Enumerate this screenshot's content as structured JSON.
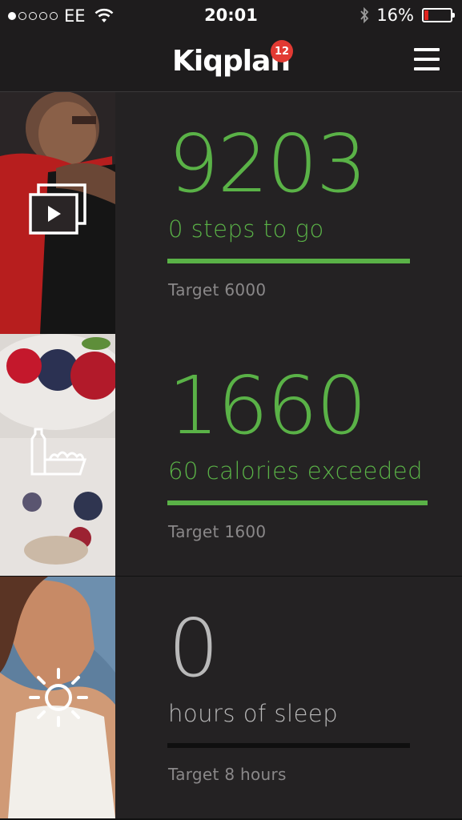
{
  "status_bar": {
    "carrier": "EE",
    "time": "20:01",
    "battery_percent": "16%",
    "battery_level": 0.16,
    "signal_dots_filled": 1,
    "signal_dots_total": 5
  },
  "header": {
    "app_name": "Kiqplan",
    "notification_count": "12",
    "menu_icon": "hamburger-menu-icon"
  },
  "colors": {
    "accent_green": "#5ab247",
    "badge_red": "#e23a33",
    "background": "#242223"
  },
  "cards": [
    {
      "icon": "video-gallery-icon",
      "value": "9203",
      "status": "0 steps to go",
      "target": "Target 6000",
      "progress": 1.0
    },
    {
      "icon": "food-icon",
      "value": "1660",
      "status": "60 calories exceeded",
      "target": "Target 1600",
      "progress": 1.0
    },
    {
      "icon": "sun-icon",
      "value": "0",
      "status": "hours of sleep",
      "target": "Target 8 hours",
      "progress": 0.0
    }
  ]
}
